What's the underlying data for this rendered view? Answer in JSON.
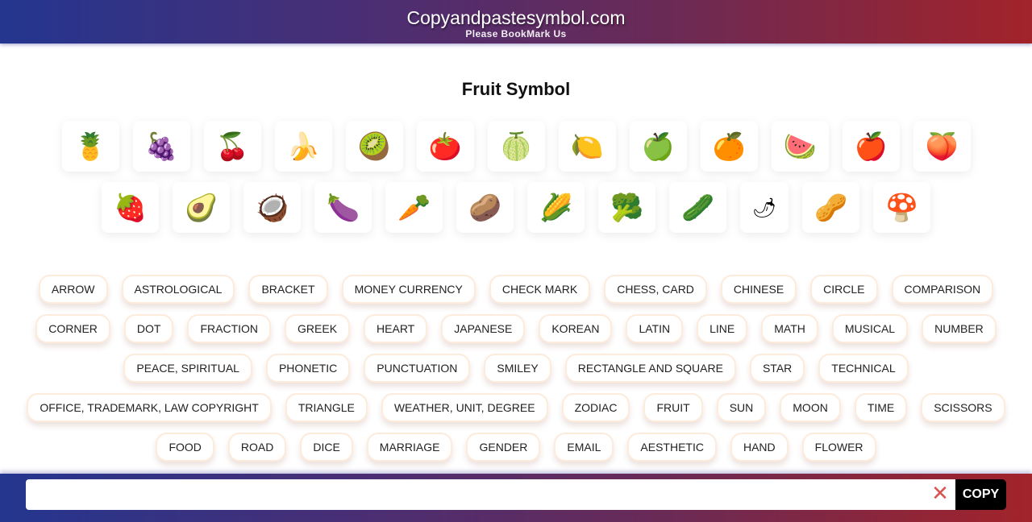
{
  "header": {
    "site_title": "Copyandpastesymbol.com",
    "subtitle": "Please BookMark Us"
  },
  "page_title": "Fruit Symbol",
  "symbols": {
    "row1": [
      {
        "char": "🍍",
        "name": "pineapple"
      },
      {
        "char": "🍇",
        "name": "grapes"
      },
      {
        "char": "🍒",
        "name": "cherries"
      },
      {
        "char": "🍌",
        "name": "banana"
      },
      {
        "char": "🥝",
        "name": "kiwi"
      },
      {
        "char": "🍅",
        "name": "tomato"
      },
      {
        "char": "🍈",
        "name": "melon"
      },
      {
        "char": "🍋",
        "name": "lemon"
      },
      {
        "char": "🍏",
        "name": "green-apple"
      },
      {
        "char": "🍊",
        "name": "tangerine"
      },
      {
        "char": "🍉",
        "name": "watermelon"
      },
      {
        "char": "🍎",
        "name": "red-apple"
      },
      {
        "char": "🍑",
        "name": "peach"
      }
    ],
    "row2": [
      {
        "char": "🍓",
        "name": "strawberry"
      },
      {
        "char": "🥑",
        "name": "avocado"
      },
      {
        "char": "🥥",
        "name": "coconut"
      },
      {
        "char": "🍆",
        "name": "eggplant"
      },
      {
        "char": "🥕",
        "name": "carrot"
      },
      {
        "char": "🥔",
        "name": "potato"
      },
      {
        "char": "🌽",
        "name": "corn"
      },
      {
        "char": "🥦",
        "name": "broccoli"
      },
      {
        "char": "🥒",
        "name": "cucumber"
      },
      {
        "char": "🌶",
        "name": "hot-pepper"
      },
      {
        "char": "🥜",
        "name": "peanuts"
      },
      {
        "char": "🍄",
        "name": "mushroom"
      }
    ]
  },
  "categories": [
    "ARROW",
    "ASTROLOGICAL",
    "BRACKET",
    "MONEY CURRENCY",
    "CHECK MARK",
    "CHESS, CARD",
    "CHINESE",
    "CIRCLE",
    "COMPARISON",
    "CORNER",
    "DOT",
    "FRACTION",
    "GREEK",
    "HEART",
    "JAPANESE",
    "KOREAN",
    "LATIN",
    "LINE",
    "MATH",
    "MUSICAL",
    "NUMBER",
    "PEACE, SPIRITUAL",
    "PHONETIC",
    "PUNCTUATION",
    "SMILEY",
    "RECTANGLE AND SQUARE",
    "STAR",
    "TECHNICAL",
    "OFFICE, TRADEMARK, LAW COPYRIGHT",
    "TRIANGLE",
    "WEATHER, UNIT, DEGREE",
    "ZODIAC",
    "FRUIT",
    "SUN",
    "MOON",
    "TIME",
    "SCISSORS",
    "FOOD",
    "ROAD",
    "DICE",
    "MARRIAGE",
    "GENDER",
    "EMAIL",
    "AESTHETIC",
    "HAND",
    "FLOWER"
  ],
  "bottombar": {
    "copy_field_value": "",
    "copy_field_placeholder": "",
    "clear_icon": "close-icon",
    "clear_glyph": "✕",
    "copy_label": "COPY"
  }
}
